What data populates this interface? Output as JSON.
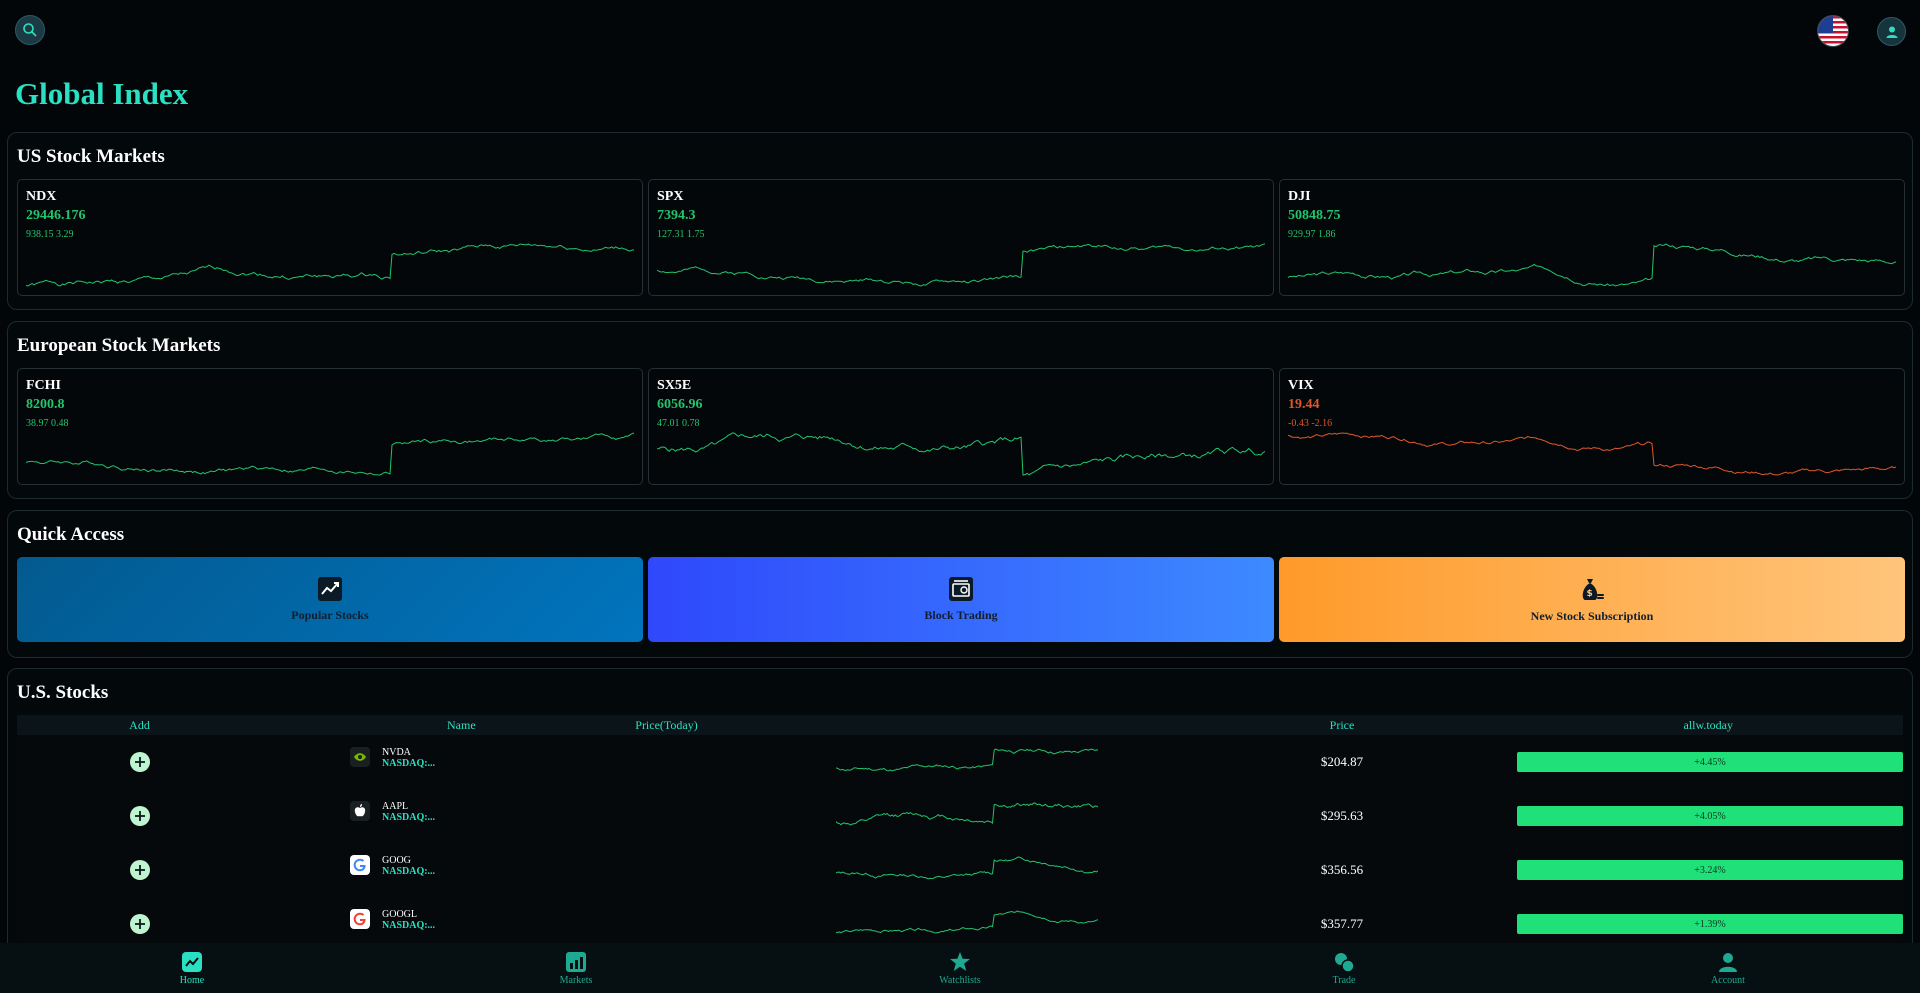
{
  "page": {
    "title": "Global Index"
  },
  "colors": {
    "accent": "#2be0c2",
    "up": "#22c46e",
    "down": "#e0562a"
  },
  "us_markets": {
    "title": "US Stock Markets",
    "cards": [
      {
        "symbol": "NDX",
        "price": "29446.176",
        "change": "938.15 3.29",
        "trend": "up"
      },
      {
        "symbol": "SPX",
        "price": "7394.3",
        "change": "127.31 1.75",
        "trend": "up"
      },
      {
        "symbol": "DJI",
        "price": "50848.75",
        "change": "929.97 1.86",
        "trend": "up"
      }
    ]
  },
  "eu_markets": {
    "title": "European Stock Markets",
    "cards": [
      {
        "symbol": "FCHI",
        "price": "8200.8",
        "change": "38.97 0.48",
        "trend": "up"
      },
      {
        "symbol": "SX5E",
        "price": "6056.96",
        "change": "47.01 0.78",
        "trend": "up"
      },
      {
        "symbol": "VIX",
        "price": "19.44",
        "change": "-0.43 -2.16",
        "trend": "down"
      }
    ]
  },
  "quick_access": {
    "title": "Quick Access",
    "items": [
      {
        "label": "Popular Stocks",
        "icon": "trend-chart-icon"
      },
      {
        "label": "Block Trading",
        "icon": "block-trading-icon"
      },
      {
        "label": "New Stock Subscription",
        "icon": "money-bag-icon"
      }
    ]
  },
  "us_stocks": {
    "title": "U.S. Stocks",
    "columns": [
      "Add",
      "Name",
      "Price(Today)",
      "Price",
      "allw.today"
    ],
    "rows": [
      {
        "ticker": "NVDA",
        "exchange": "NASDAQ:...",
        "price": "$204.87",
        "change_pct": "+4.45%",
        "logo": "nvidia-logo-icon"
      },
      {
        "ticker": "AAPL",
        "exchange": "NASDAQ:...",
        "price": "$295.63",
        "change_pct": "+4.05%",
        "logo": "apple-logo-icon"
      },
      {
        "ticker": "GOOG",
        "exchange": "NASDAQ:...",
        "price": "$356.56",
        "change_pct": "+3.24%",
        "logo": "google-logo-icon"
      },
      {
        "ticker": "GOOGL",
        "exchange": "NASDAQ:...",
        "price": "$357.77",
        "change_pct": "+1.39%",
        "logo": "google-logo-icon"
      }
    ]
  },
  "nav": {
    "items": [
      {
        "label": "Home",
        "icon": "home-chart-icon",
        "active": true
      },
      {
        "label": "Markets",
        "icon": "markets-icon",
        "active": false
      },
      {
        "label": "Watchlists",
        "icon": "watchlist-star-icon",
        "active": false
      },
      {
        "label": "Trade",
        "icon": "trade-icon",
        "active": false
      },
      {
        "label": "Account",
        "icon": "account-icon",
        "active": false
      }
    ]
  }
}
